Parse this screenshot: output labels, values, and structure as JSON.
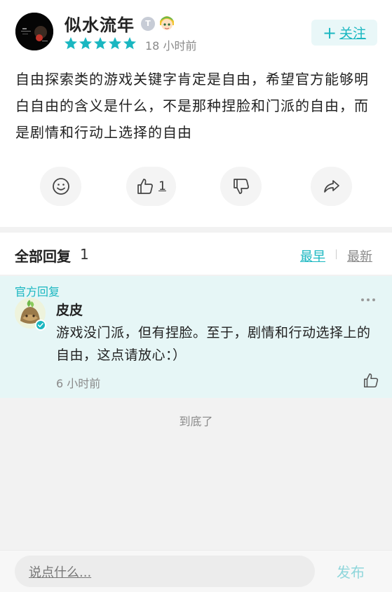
{
  "post": {
    "username": "似水流年",
    "badge_t": "T",
    "rating_stars": 5,
    "time": "18 小时前",
    "follow_label": "关注",
    "follow_plus": "+",
    "text": "自由探索类的游戏关键字肯定是自由，希望官方能够明白自由的含义是什么，不是那种捏脸和门派的自由，而是剧情和行动上选择的自由",
    "like_count": "1",
    "accent_color": "#1ab7c1"
  },
  "replies": {
    "title": "全部回复",
    "count": "1",
    "sort_earliest": "最早",
    "sort_newest": "最新"
  },
  "official_reply": {
    "tag": "官方回复",
    "author": "皮皮",
    "text": "游戏没门派，但有捏脸。至于，剧情和行动选择上的自由，这点请放心：）",
    "time": "6 小时前"
  },
  "end_text": "到底了",
  "bottom_bar": {
    "placeholder": "说点什么...",
    "publish_label": "发布"
  }
}
